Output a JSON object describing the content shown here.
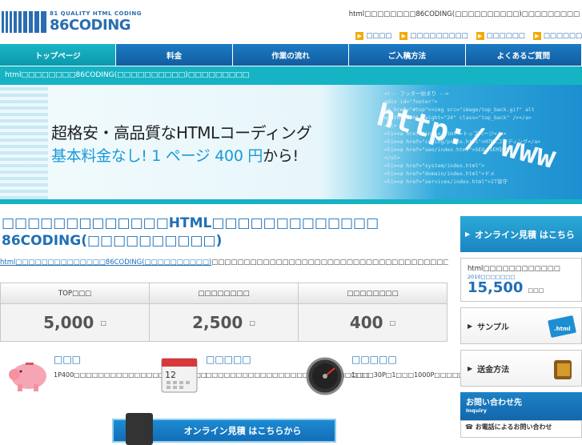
{
  "header": {
    "logo_small": "81 QUALITY HTML CODING",
    "logo_big": "86CODING",
    "tagline": "html□□□□□□□□86CODING(□□□□□□□□□□)□□□□□□□□□",
    "links": [
      "□□□□",
      "□□□□□□□□□",
      "□□□□□□",
      "□□□□□□"
    ]
  },
  "nav": [
    "トップページ",
    "料金",
    "作業の流れ",
    "ご入稿方法",
    "よくあるご質問"
  ],
  "breadcrumb": "html□□□□□□□□86CODING(□□□□□□□□□□)□□□□□□□□□",
  "banner": {
    "line1": "超格安・高品質なHTMLコーディング",
    "line2_a": "基本料金なし! 1 ページ 400 円",
    "line2_b": "から!",
    "http": "http://www",
    "code_lines": [
      "<!-- フッター始まり -->",
      "<div id=\"footer\">",
      "<a href=\"#top\"><img src=\"image/top_back.gif\" alt",
      "width=\"100\" height=\"24\" class=\"top_back\" /></a>",
      "<ul>",
      "<li><a href=\"index.html\">トップページ</a>",
      "<li><a href=\"coding/price.html\">HTMLコーディング</a>",
      "<li><a href=\"seo/index.html\">SEO・SEM対策",
      "</ul>",
      "<li><a href=\"system/index.html\">",
      "<li><a href=\"domain/index.html\">ドメ",
      "<li><a href=\"services/index.html\">IT保守"
    ]
  },
  "main": {
    "title": "□□□□□□□□□□□□□HTML□□□□□□□□□□□□□ 86CODING(□□□□□□□□□□)",
    "desc_link": "html□□□□□□□□□□□□□□86CODING(□□□□□□□□□□)",
    "desc_rest": "□□□□□□□□□□□□□□□□□□□□□□□□□□□□□□□□□□□□□□□□□□□□□□□□□□□□□□□",
    "prices": [
      {
        "label": "TOP□□□",
        "value": "5,000",
        "unit": "□"
      },
      {
        "label": "□□□□□□□□",
        "value": "2,500",
        "unit": "□"
      },
      {
        "label": "□□□□□□□□",
        "value": "400",
        "unit": "□"
      }
    ],
    "features": [
      {
        "title": "□□□",
        "text": "1P400□□□□□□□□□□□□□□□□□□□□□□"
      },
      {
        "title": "□□□□□",
        "text": "□□□□□□□□□□□□□□□□□□□□□□□□□□□"
      },
      {
        "title": "□□□□□",
        "text": "1□□□30P□1□□□1000P□□□□□□□□□□□□"
      }
    ],
    "estimate_button": "オンライン見積 はこちらから"
  },
  "side": {
    "online": "オンライン見積 はこちら",
    "count_label": "html□□□□□□□□□□□□",
    "count_since": "2010□□□□□□□",
    "count_value": "15,500",
    "count_unit": "□□□",
    "links": [
      "サンプル",
      "送金方法"
    ],
    "contact_title": "お問い合わせ先",
    "contact_sub": "Inquiry",
    "tel_label": "お電話によるお問い合わせ"
  },
  "colors": {
    "brand": "#2a6db0",
    "teal": "#16b3c4",
    "nav": "#1c7bc4"
  }
}
